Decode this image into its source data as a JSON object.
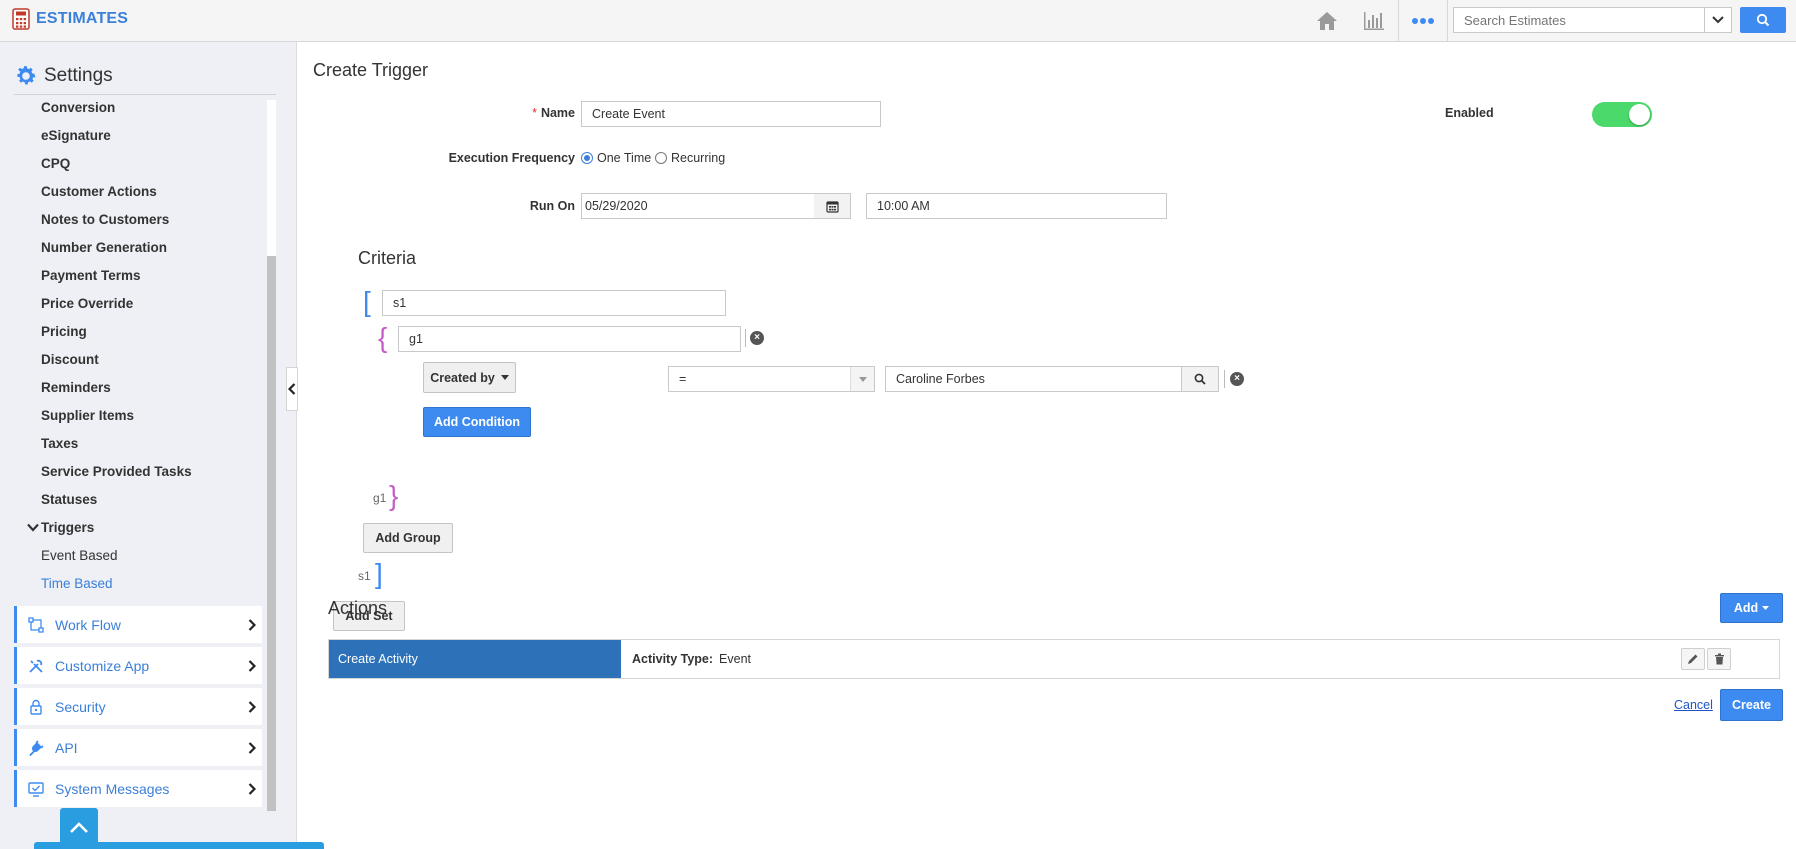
{
  "app": {
    "title": "ESTIMATES"
  },
  "search": {
    "placeholder": "Search Estimates"
  },
  "sidebar": {
    "heading": "Settings",
    "items": [
      {
        "label": "Conversion"
      },
      {
        "label": "eSignature"
      },
      {
        "label": "CPQ"
      },
      {
        "label": "Customer Actions"
      },
      {
        "label": "Notes to Customers"
      },
      {
        "label": "Number Generation"
      },
      {
        "label": "Payment Terms"
      },
      {
        "label": "Price Override"
      },
      {
        "label": "Pricing"
      },
      {
        "label": "Discount"
      },
      {
        "label": "Reminders"
      },
      {
        "label": "Supplier Items"
      },
      {
        "label": "Taxes"
      },
      {
        "label": "Service Provided Tasks"
      },
      {
        "label": "Statuses"
      },
      {
        "label": "Triggers"
      }
    ],
    "sub_items": [
      {
        "label": "Event Based"
      },
      {
        "label": "Time Based"
      }
    ],
    "panels": [
      {
        "label": "Work Flow"
      },
      {
        "label": "Customize App"
      },
      {
        "label": "Security"
      },
      {
        "label": "API"
      },
      {
        "label": "System Messages"
      }
    ]
  },
  "form": {
    "title": "Create Trigger",
    "name_label": "Name",
    "name_value": "Create Event",
    "enabled_label": "Enabled",
    "frequency_label": "Execution Frequency",
    "frequency_options": [
      "One Time",
      "Recurring"
    ],
    "run_on_label": "Run On",
    "run_on_date": "05/29/2020",
    "run_on_time": "10:00 AM"
  },
  "criteria": {
    "title": "Criteria",
    "set_name": "s1",
    "group_name": "g1",
    "field": "Created by",
    "operator": "=",
    "value": "Caroline Forbes",
    "add_condition": "Add Condition",
    "add_group": "Add Group",
    "add_set": "Add Set",
    "group_end_tag": "g1",
    "set_end_tag": "s1"
  },
  "actions": {
    "title": "Actions",
    "add_label": "Add",
    "rows": [
      {
        "name": "Create Activity",
        "field_label": "Activity Type:",
        "field_value": "Event"
      }
    ],
    "cancel": "Cancel",
    "create": "Create"
  },
  "colors": {
    "accent": "#3d8bf0",
    "brand": "#3a7fd8",
    "toggle_on": "#4cd96b",
    "action_row": "#2d72b8"
  }
}
